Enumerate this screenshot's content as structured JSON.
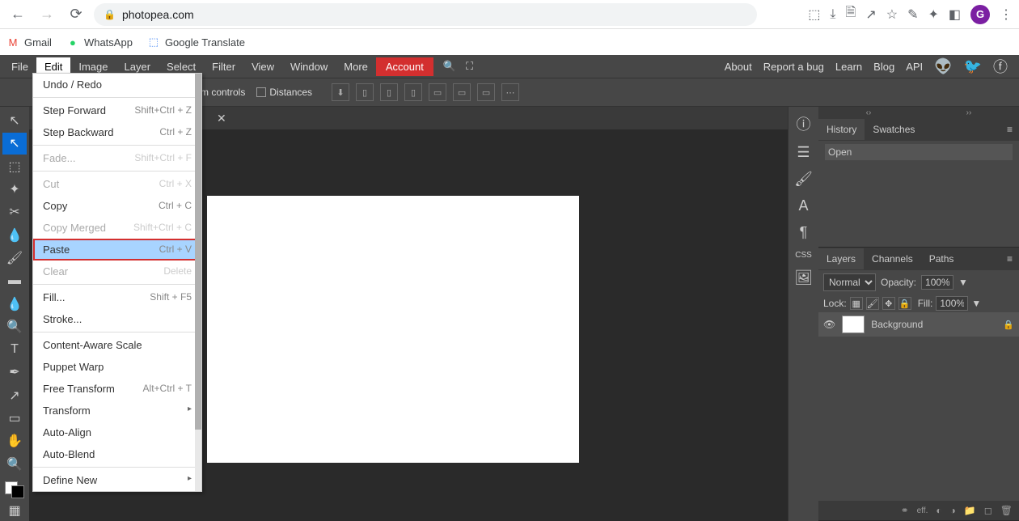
{
  "browser": {
    "url": "photopea.com",
    "bookmarks": [
      {
        "label": "Gmail"
      },
      {
        "label": "WhatsApp"
      },
      {
        "label": "Google Translate"
      }
    ],
    "avatar_letter": "G"
  },
  "menubar": {
    "items": [
      "File",
      "Edit",
      "Image",
      "Layer",
      "Select",
      "Filter",
      "View",
      "Window",
      "More"
    ],
    "account": "Account",
    "right_links": [
      "About",
      "Report a bug",
      "Learn",
      "Blog",
      "API"
    ]
  },
  "options_bar": {
    "transform_controls": "sform controls",
    "distances": "Distances"
  },
  "edit_menu": {
    "items": [
      {
        "label": "Undo / Redo",
        "shortcut": "",
        "disabled": false
      },
      {
        "sep": true
      },
      {
        "label": "Step Forward",
        "shortcut": "Shift+Ctrl + Z",
        "disabled": false
      },
      {
        "label": "Step Backward",
        "shortcut": "Ctrl + Z",
        "disabled": false
      },
      {
        "sep": true
      },
      {
        "label": "Fade...",
        "shortcut": "Shift+Ctrl + F",
        "disabled": true
      },
      {
        "sep": true
      },
      {
        "label": "Cut",
        "shortcut": "Ctrl + X",
        "disabled": true
      },
      {
        "label": "Copy",
        "shortcut": "Ctrl + C",
        "disabled": false
      },
      {
        "label": "Copy Merged",
        "shortcut": "Shift+Ctrl + C",
        "disabled": true
      },
      {
        "label": "Paste",
        "shortcut": "Ctrl + V",
        "disabled": false,
        "highlighted": true
      },
      {
        "label": "Clear",
        "shortcut": "Delete",
        "disabled": true
      },
      {
        "sep": true
      },
      {
        "label": "Fill...",
        "shortcut": "Shift + F5",
        "disabled": false
      },
      {
        "label": "Stroke...",
        "shortcut": "",
        "disabled": false
      },
      {
        "sep": true
      },
      {
        "label": "Content-Aware Scale",
        "shortcut": "",
        "disabled": false
      },
      {
        "label": "Puppet Warp",
        "shortcut": "",
        "disabled": false
      },
      {
        "label": "Free Transform",
        "shortcut": "Alt+Ctrl + T",
        "disabled": false
      },
      {
        "label": "Transform",
        "shortcut": "",
        "submenu": true,
        "disabled": false
      },
      {
        "label": "Auto-Align",
        "shortcut": "",
        "disabled": false
      },
      {
        "label": "Auto-Blend",
        "shortcut": "",
        "disabled": false
      },
      {
        "sep": true
      },
      {
        "label": "Define New",
        "shortcut": "",
        "submenu": true,
        "disabled": false
      }
    ]
  },
  "panels": {
    "history": {
      "tabs": [
        "History",
        "Swatches"
      ],
      "items": [
        "Open"
      ]
    },
    "layers": {
      "tabs": [
        "Layers",
        "Channels",
        "Paths"
      ],
      "blend_mode": "Normal",
      "opacity_label": "Opacity:",
      "opacity": "100%",
      "lock_label": "Lock:",
      "fill_label": "Fill:",
      "fill": "100%",
      "items": [
        {
          "name": "Background",
          "locked": true
        }
      ]
    }
  }
}
